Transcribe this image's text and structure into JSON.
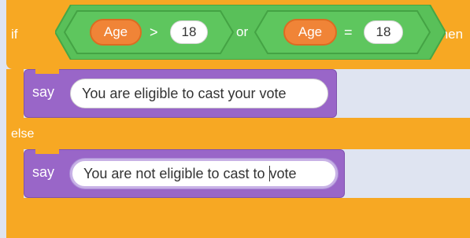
{
  "if_block": {
    "if_label": "if",
    "then_label": "then",
    "else_label": "else",
    "condition": {
      "left": {
        "reporter": "Age",
        "operator": ">",
        "value": "18"
      },
      "joiner": "or",
      "right": {
        "reporter": "Age",
        "operator": "=",
        "value": "18"
      }
    }
  },
  "say_blocks": [
    {
      "label": "say",
      "text": "You are eligible to cast your vote"
    },
    {
      "label": "say",
      "text_before_caret": "You are not eligible to cast to ",
      "text_after_caret": "vote"
    }
  ],
  "colors": {
    "control": "#f7a823",
    "looks": "#9966c8",
    "variable_reporter": "#f08437",
    "operator": "#59c059",
    "canvas": "#dfe4f1"
  }
}
